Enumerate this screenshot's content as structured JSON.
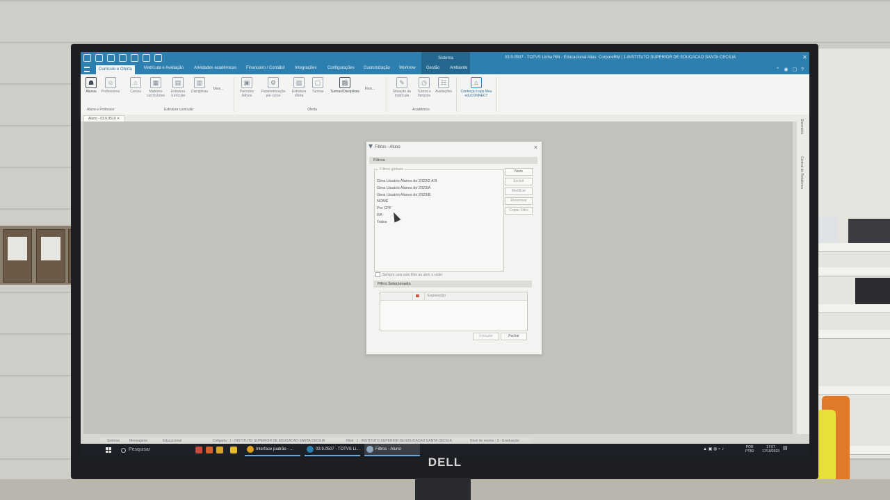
{
  "app": {
    "qat_tab_context": "Sistema",
    "title": "03.9.0507 - TOTVS Linha RM - Educacional  Alias: CorporeRM | 1-INSTITUTO SUPERIOR DE EDUCACAO SANTA CECILIA"
  },
  "tabs": [
    {
      "label": "Currículo e Oferta",
      "active": true
    },
    {
      "label": "Matrícula e Avaliação"
    },
    {
      "label": "Atividades acadêmicas"
    },
    {
      "label": "Financeiro / Contábil"
    },
    {
      "label": "Integrações"
    },
    {
      "label": "Configurações"
    },
    {
      "label": "Customização"
    },
    {
      "label": "Workrow"
    },
    {
      "label": "Gestão"
    },
    {
      "label": "Ambiente"
    }
  ],
  "ribbon": {
    "buttons": [
      {
        "label": "Alunos",
        "icon": "student-icon"
      },
      {
        "label": "Professores",
        "icon": "person-icon"
      },
      {
        "label": "Cursos",
        "icon": "course-icon"
      },
      {
        "label": "Matrizes curriculares",
        "icon": "matrix-icon"
      },
      {
        "label": "Estrutura curricular",
        "icon": "structure-icon"
      },
      {
        "label": "Disciplinas",
        "icon": "book-icon"
      },
      {
        "label": "Mais...",
        "icon": "more-icon"
      },
      {
        "label": "Períodos letivos",
        "icon": "calendar-icon"
      },
      {
        "label": "Parametrização por curso",
        "icon": "settings-icon"
      },
      {
        "label": "Estrutura oferta",
        "icon": "offer-icon"
      },
      {
        "label": "Turmas",
        "icon": "class-icon"
      },
      {
        "label": "Turmas/Disciplinas",
        "icon": "class-subject-icon"
      },
      {
        "label": "Mais...",
        "icon": "more-icon"
      },
      {
        "label": "Situação de matrícula",
        "icon": "enroll-status-icon"
      },
      {
        "label": "Turnos e horários",
        "icon": "clock-icon"
      },
      {
        "label": "Avaliações",
        "icon": "evaluation-icon"
      },
      {
        "label": "Conheça o app Meu eduCONNECT",
        "icon": "graduation-cap-icon"
      }
    ],
    "groups": [
      "Aluno e Professor",
      "Estrutura curricular",
      "Oferta",
      "Acadêmico"
    ]
  },
  "doc_tab": "Aluno - 03.9.0519",
  "side_panel": [
    "Dicionário",
    "Central de Relatórios"
  ],
  "dialog": {
    "title": "Filtros - Aluno",
    "section_filters": "Filtros",
    "group_label": "Filtros globais",
    "filters": [
      "Gera Usuário Alunos de 2023/2 A B",
      "Gera Usuário Alunos de 2023/A",
      "Gera Usuário Alunos de 2023/B",
      "NOME",
      "Por CPF",
      "RA",
      "Todos"
    ],
    "buttons": {
      "novo": "Novo",
      "excluir": "Excluir",
      "modificar": "Modificar",
      "renomear": "Renomear",
      "copiar": "Copiar Filtro"
    },
    "checkbox_label": "Sempre usar este filtro ao abrir a visão",
    "section_selected": "Filtro Selecionado",
    "grid_column": "Expressão",
    "executar": "Executar",
    "fechar": "Fechar"
  },
  "statusbar": {
    "sistema": "Sistema",
    "mensagens": "Mensagens",
    "educacional": "Educacional",
    "coligada": "Coligada : 1 - INSTITUTO SUPERIOR DE EDUCACAO SANTA CECILIA",
    "filial": "Filial : 1 - INSTITUTO SUPERIOR DE EDUCACAO SANTA CECILIA",
    "nivel": "Nível de ensino : 3 - Graduação"
  },
  "taskbar": {
    "search": "Pesquisar",
    "apps": [
      {
        "label": "Interface padrão - ...",
        "color": "#e0a020"
      },
      {
        "label": "03.9.0507 - TOTVS Li...",
        "color": "#2c7fae"
      },
      {
        "label": "Filtros - Aluno",
        "color": "#8fa8c0",
        "active": true
      }
    ],
    "lang": "POR",
    "lang2": "PTB2",
    "time": "17:07",
    "date": "17/10/2023"
  },
  "monitor_brand": "DELL"
}
